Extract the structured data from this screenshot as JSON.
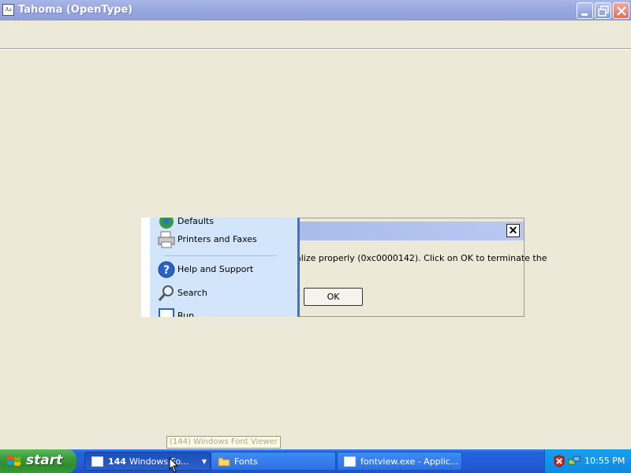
{
  "window": {
    "title": "Tahoma (OpenType)"
  },
  "dialog": {
    "message": "alize properly (0xc0000142). Click on OK to terminate the",
    "ok_label": "OK",
    "close_glyph": "✕"
  },
  "start_menu": {
    "items": [
      {
        "label": "Defaults",
        "icon": "set-program-access-defaults-icon"
      },
      {
        "label": "Printers and Faxes",
        "icon": "printer-icon"
      },
      {
        "label": "Help and Support",
        "icon": "help-icon"
      },
      {
        "label": "Search",
        "icon": "search-icon"
      },
      {
        "label": "Run...",
        "icon": "run-icon"
      }
    ]
  },
  "tooltip": {
    "text": "(144) Windows Font Viewer"
  },
  "taskbar": {
    "start_label": "start",
    "buttons": [
      {
        "count": "144",
        "label": "Windows Fo...",
        "icon": "font-viewer-icon",
        "active": true
      },
      {
        "label": "Fonts",
        "icon": "folder-icon",
        "active": false
      },
      {
        "label": "fontview.exe - Applic...",
        "icon": "application-window-icon",
        "active": false
      }
    ],
    "tray": {
      "icons": [
        "security-alert-icon",
        "network-icon"
      ],
      "clock": "10:55 PM"
    }
  },
  "colors": {
    "title_bar": "#9aa9e0",
    "desktop_bg": "#ece9d8",
    "taskbar": "#245edb",
    "start_green": "#3c9b3c",
    "tray": "#0f88de",
    "menu_pane": "#d3e5fa"
  }
}
